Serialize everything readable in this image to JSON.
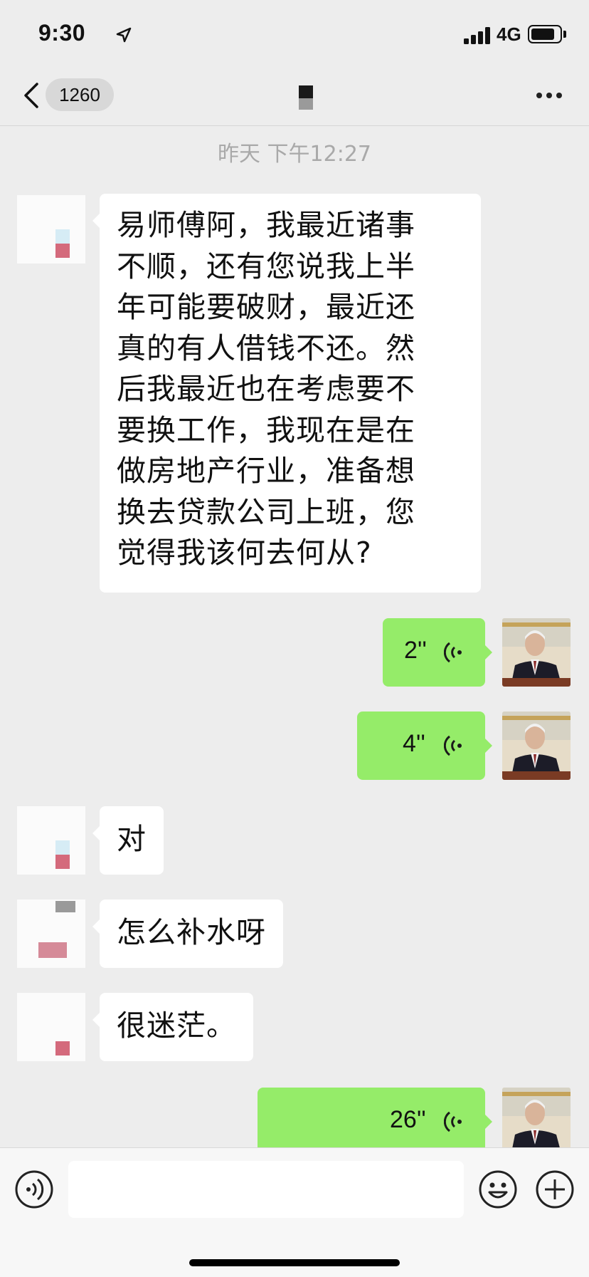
{
  "status_bar": {
    "time": "9:30",
    "network": "4G",
    "icons": [
      "location-arrow-icon",
      "signal-icon",
      "battery-icon"
    ]
  },
  "nav": {
    "back_icon": "chevron-left-icon",
    "unread_count": "1260",
    "more_icon": "more-dots-icon"
  },
  "chat": {
    "timestamp": "昨天 下午12:27",
    "messages": [
      {
        "side": "left",
        "lines": [
          "易师傅阿，我最近诸事",
          "不顺，还有您说我上半",
          "年可能要破财，最近还",
          "真的有人借钱不还。然",
          "后我最近也在考虑要不",
          "要换工作，我现在是在",
          "做房地产行业，准备想",
          "换去贷款公司上班，您",
          "觉得我该何去何从?"
        ]
      },
      {
        "side": "right",
        "type": "voice",
        "duration": "2''"
      },
      {
        "side": "right",
        "type": "voice",
        "duration": "4''"
      },
      {
        "side": "left",
        "text": "对"
      },
      {
        "side": "left",
        "text": "怎么补水呀"
      },
      {
        "side": "left",
        "text": "很迷茫。"
      },
      {
        "side": "right",
        "type": "voice",
        "duration": "26''"
      }
    ]
  },
  "input_bar": {
    "voice_icon": "voice-toggle-icon",
    "emoji_icon": "emoji-icon",
    "plus_icon": "plus-icon",
    "text_value": ""
  },
  "colors": {
    "background": "#ededed",
    "sent_bubble": "#95ec69",
    "received_bubble": "#ffffff"
  }
}
